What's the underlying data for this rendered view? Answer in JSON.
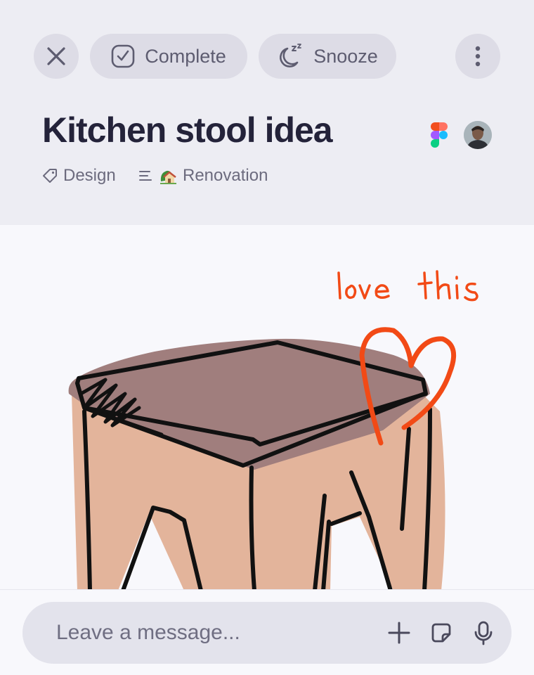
{
  "toolbar": {
    "complete_label": "Complete",
    "snooze_label": "Snooze"
  },
  "task": {
    "title": "Kitchen stool idea",
    "tag": "Design",
    "project": "Renovation"
  },
  "sketch": {
    "annotation": "love this",
    "annotation_color": "#f24a16",
    "seat_color": "#a07e7d",
    "body_color": "#e3b49b"
  },
  "composer": {
    "placeholder": "Leave a message..."
  },
  "icons": [
    "close-icon",
    "check-square-icon",
    "snooze-moon-icon",
    "more-vertical-icon",
    "figma-icon",
    "avatar",
    "tag-icon",
    "list-icon",
    "house-emoji-icon",
    "plus-icon",
    "sticker-icon",
    "mic-icon"
  ]
}
